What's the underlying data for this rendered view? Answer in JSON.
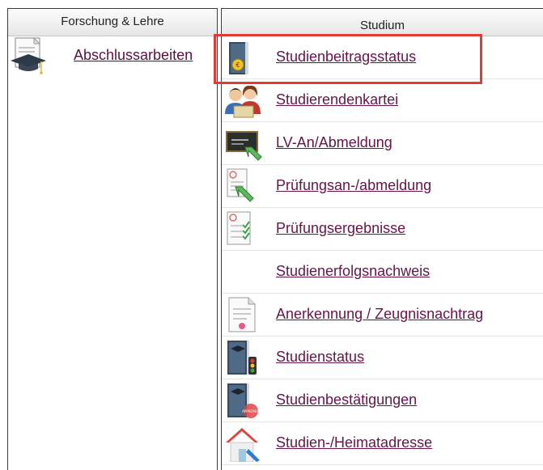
{
  "left_panel": {
    "header": "Forschung & Lehre",
    "items": [
      {
        "label": "Abschlussarbeiten",
        "icon": "thesis-graduation-icon"
      }
    ]
  },
  "right_panel": {
    "header": "Studium",
    "items": [
      {
        "label": "Studienbeitragsstatus",
        "icon": "fee-status-book-icon"
      },
      {
        "label": "Studierendenkartei",
        "icon": "students-icon"
      },
      {
        "label": "LV-An/Abmeldung",
        "icon": "course-registration-icon"
      },
      {
        "label": "Prüfungsan-/abmeldung",
        "icon": "exam-registration-icon"
      },
      {
        "label": "Prüfungsergebnisse",
        "icon": "exam-results-icon"
      },
      {
        "label": "Studienerfolgsnachweis",
        "icon": ""
      },
      {
        "label": "Anerkennung / Zeugnisnachtrag",
        "icon": "certificate-document-icon"
      },
      {
        "label": "Studienstatus",
        "icon": "study-status-traffic-light-icon"
      },
      {
        "label": "Studienbestätigungen",
        "icon": "study-confirmation-book-icon"
      },
      {
        "label": "Studien-/Heimatadresse",
        "icon": "home-address-icon"
      }
    ]
  },
  "highlight_color": "#e53935",
  "link_color": "#68134a"
}
